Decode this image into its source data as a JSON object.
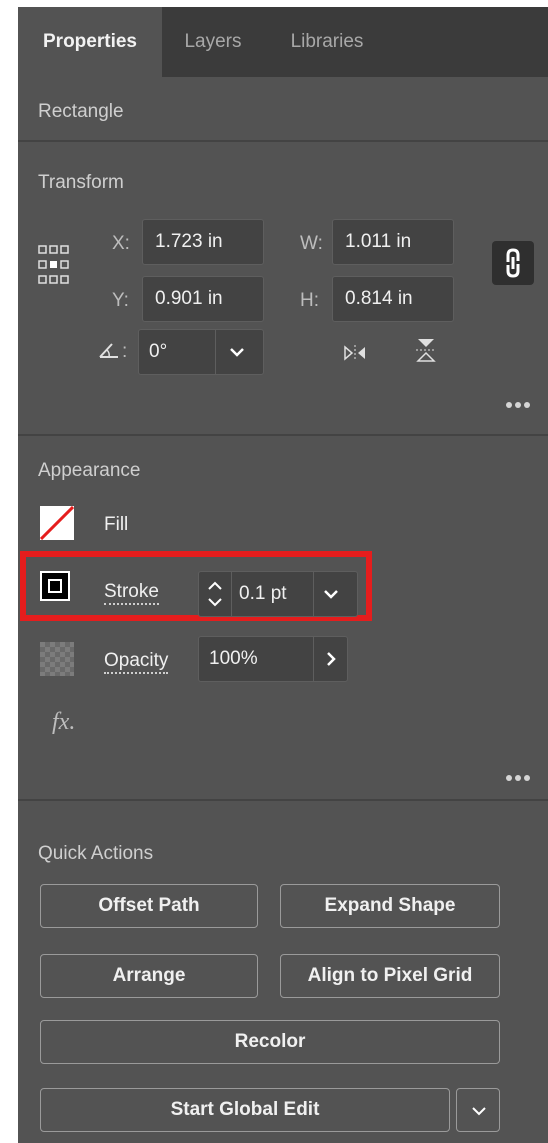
{
  "tabs": {
    "properties": "Properties",
    "layers": "Layers",
    "libraries": "Libraries"
  },
  "object_type": "Rectangle",
  "transform": {
    "title": "Transform",
    "x_label": "X:",
    "x_value": "1.723 in",
    "y_label": "Y:",
    "y_value": "0.901 in",
    "w_label": "W:",
    "w_value": "1.011 in",
    "h_label": "H:",
    "h_value": "0.814 in",
    "angle_label": ":",
    "angle_value": "0°",
    "link_icon": "link-icon",
    "reference_point_icon": "reference-point-icon",
    "flip_icons": [
      "flip-horizontal-icon",
      "flip-vertical-icon"
    ]
  },
  "appearance": {
    "title": "Appearance",
    "fill_label": "Fill",
    "stroke_label": "Stroke",
    "stroke_weight": "0.1 pt",
    "opacity_label": "Opacity",
    "opacity_value": "100%",
    "fx_label": "fx."
  },
  "quick_actions": {
    "title": "Quick Actions",
    "offset_path": "Offset Path",
    "expand_shape": "Expand Shape",
    "arrange": "Arrange",
    "align_pixel": "Align to Pixel Grid",
    "recolor": "Recolor",
    "global_edit": "Start Global Edit"
  },
  "colors": {
    "panel": "#535353",
    "tab_bar": "#3b3b3b",
    "highlight": "#e51d1d",
    "field": "#434343"
  }
}
